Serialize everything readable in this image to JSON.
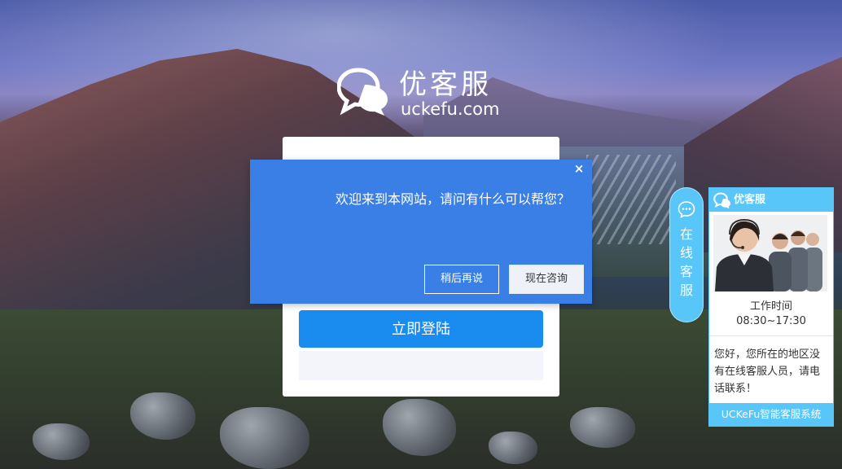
{
  "logo": {
    "title": "优客服",
    "subtitle": "uckefu.com",
    "icon": "chat-bubbles-icon"
  },
  "login": {
    "submit_label": "立即登陆"
  },
  "popup": {
    "close_glyph": "×",
    "message": "欢迎来到本网站，请问有什么可以帮您？",
    "later_label": "稍后再说",
    "consult_label": "现在咨询"
  },
  "side_tab": {
    "icon": "chat-icon",
    "label": "在\n线\n客\n服"
  },
  "support_panel": {
    "title": "优客服",
    "hours_label": "工作时间",
    "hours": "08:30~17:30",
    "note": "您好，您所在的地区没有在线客服人员，请电话联系！",
    "footer": "UCKeFu智能客服系统"
  },
  "colors": {
    "popup_bg": "#3a7fe6",
    "login_button": "#1a8cf0",
    "panel_accent": "#58c6f9"
  }
}
